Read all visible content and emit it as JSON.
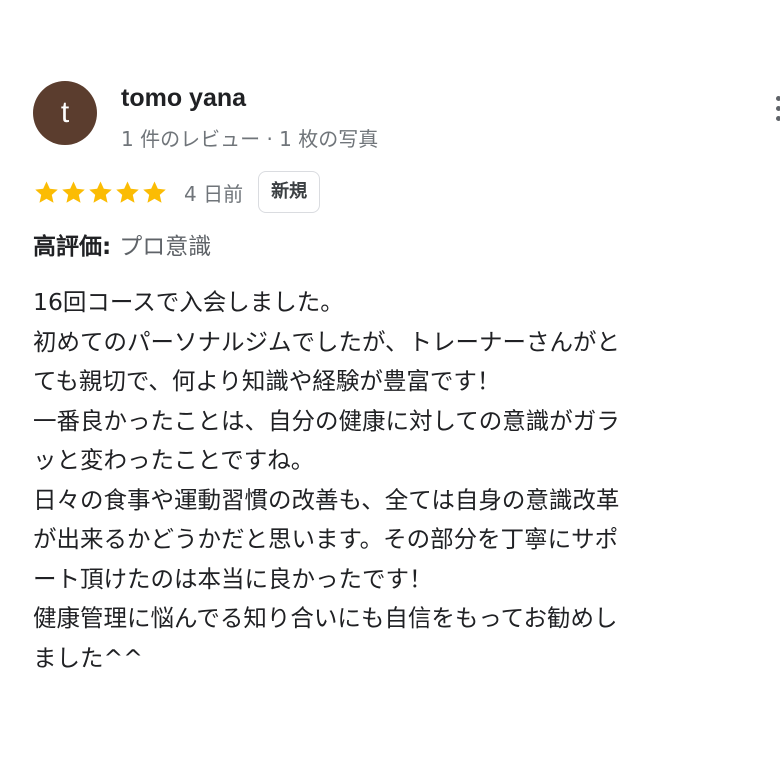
{
  "author": {
    "initial": "t",
    "avatar_color": "#5b3d2e",
    "name": "tomo yana",
    "meta": "1 件のレビュー · 1 枚の写真"
  },
  "rating": {
    "stars": 5,
    "max_stars": 5,
    "star_color": "#fbbc04",
    "date": "4 日前",
    "badge": "新規"
  },
  "highlight": {
    "label": "高評価:",
    "value": "プロ意識"
  },
  "body": {
    "lines": [
      "16回コースで入会しました。",
      "初めてのパーソナルジムでしたが、トレーナーさんがと",
      "ても親切で、何より知識や経験が豊富です！",
      "一番良かったことは、自分の健康に対しての意識がガラ",
      "ッと変わったことですね。",
      "日々の食事や運動習慣の改善も、全ては自身の意識改革",
      "が出来るかどうかだと思います。その部分を丁寧にサポ",
      "ート頂けたのは本当に良かったです！",
      "健康管理に悩んでる知り合いにも自信をもってお勧めし",
      "ました^^"
    ]
  },
  "icons": {
    "more": "more-vert-icon",
    "star": "star-icon"
  }
}
